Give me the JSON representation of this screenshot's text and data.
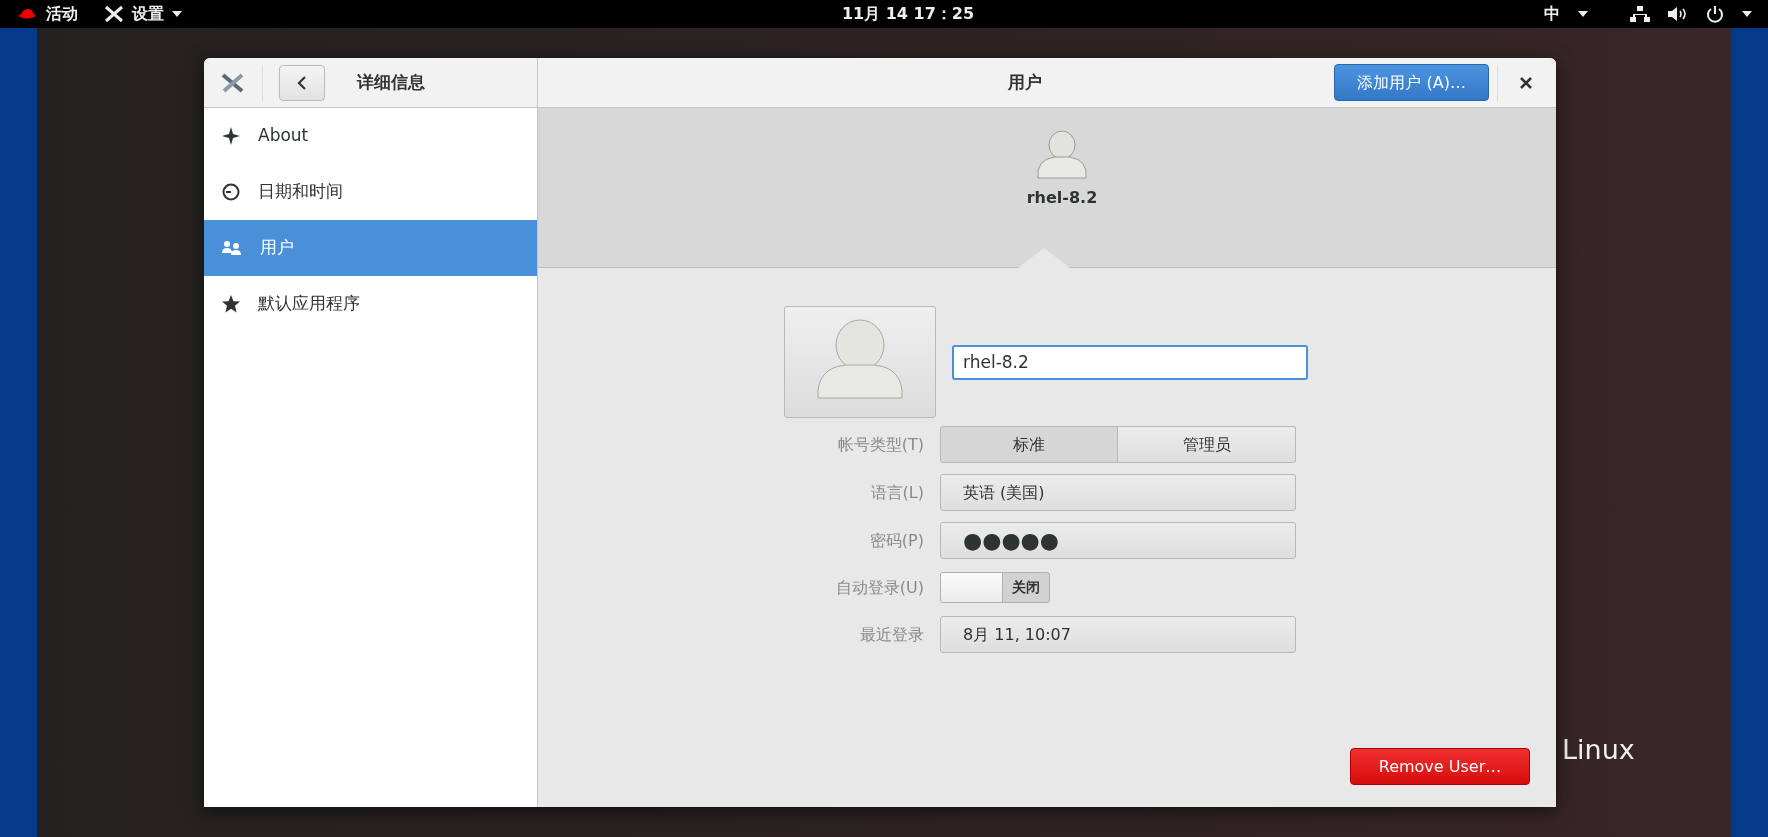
{
  "top_bar": {
    "activities": "活动",
    "app_menu": "设置",
    "clock": "11月 14  17：25",
    "input_method": "中"
  },
  "window": {
    "sidebar_title": "详细信息",
    "title": "用户",
    "add_button": "添加用户 (A)…"
  },
  "sidebar": {
    "items": [
      {
        "label": "About",
        "selected": false
      },
      {
        "label": "日期和时间",
        "selected": false
      },
      {
        "label": "用户",
        "selected": true
      },
      {
        "label": "默认应用程序",
        "selected": false
      }
    ]
  },
  "user_header": {
    "name": "rhel-8.2"
  },
  "form": {
    "name_value": "rhel-8.2",
    "account_type": {
      "label": "帐号类型(T)",
      "options": [
        {
          "label": "标准",
          "selected": true
        },
        {
          "label": "管理员",
          "selected": false
        }
      ]
    },
    "language": {
      "label": "语言(L)",
      "value": "英语 (美国)"
    },
    "password": {
      "label": "密码(P)",
      "value": "●●●●●"
    },
    "auto_login": {
      "label": "自动登录(U)",
      "on": false,
      "state_text": "关闭"
    },
    "last_login": {
      "label": "最近登录",
      "value": "8月 11, 10:07"
    }
  },
  "remove_button": "Remove User…",
  "desktop": {
    "wallpaper_text": "Linux"
  }
}
